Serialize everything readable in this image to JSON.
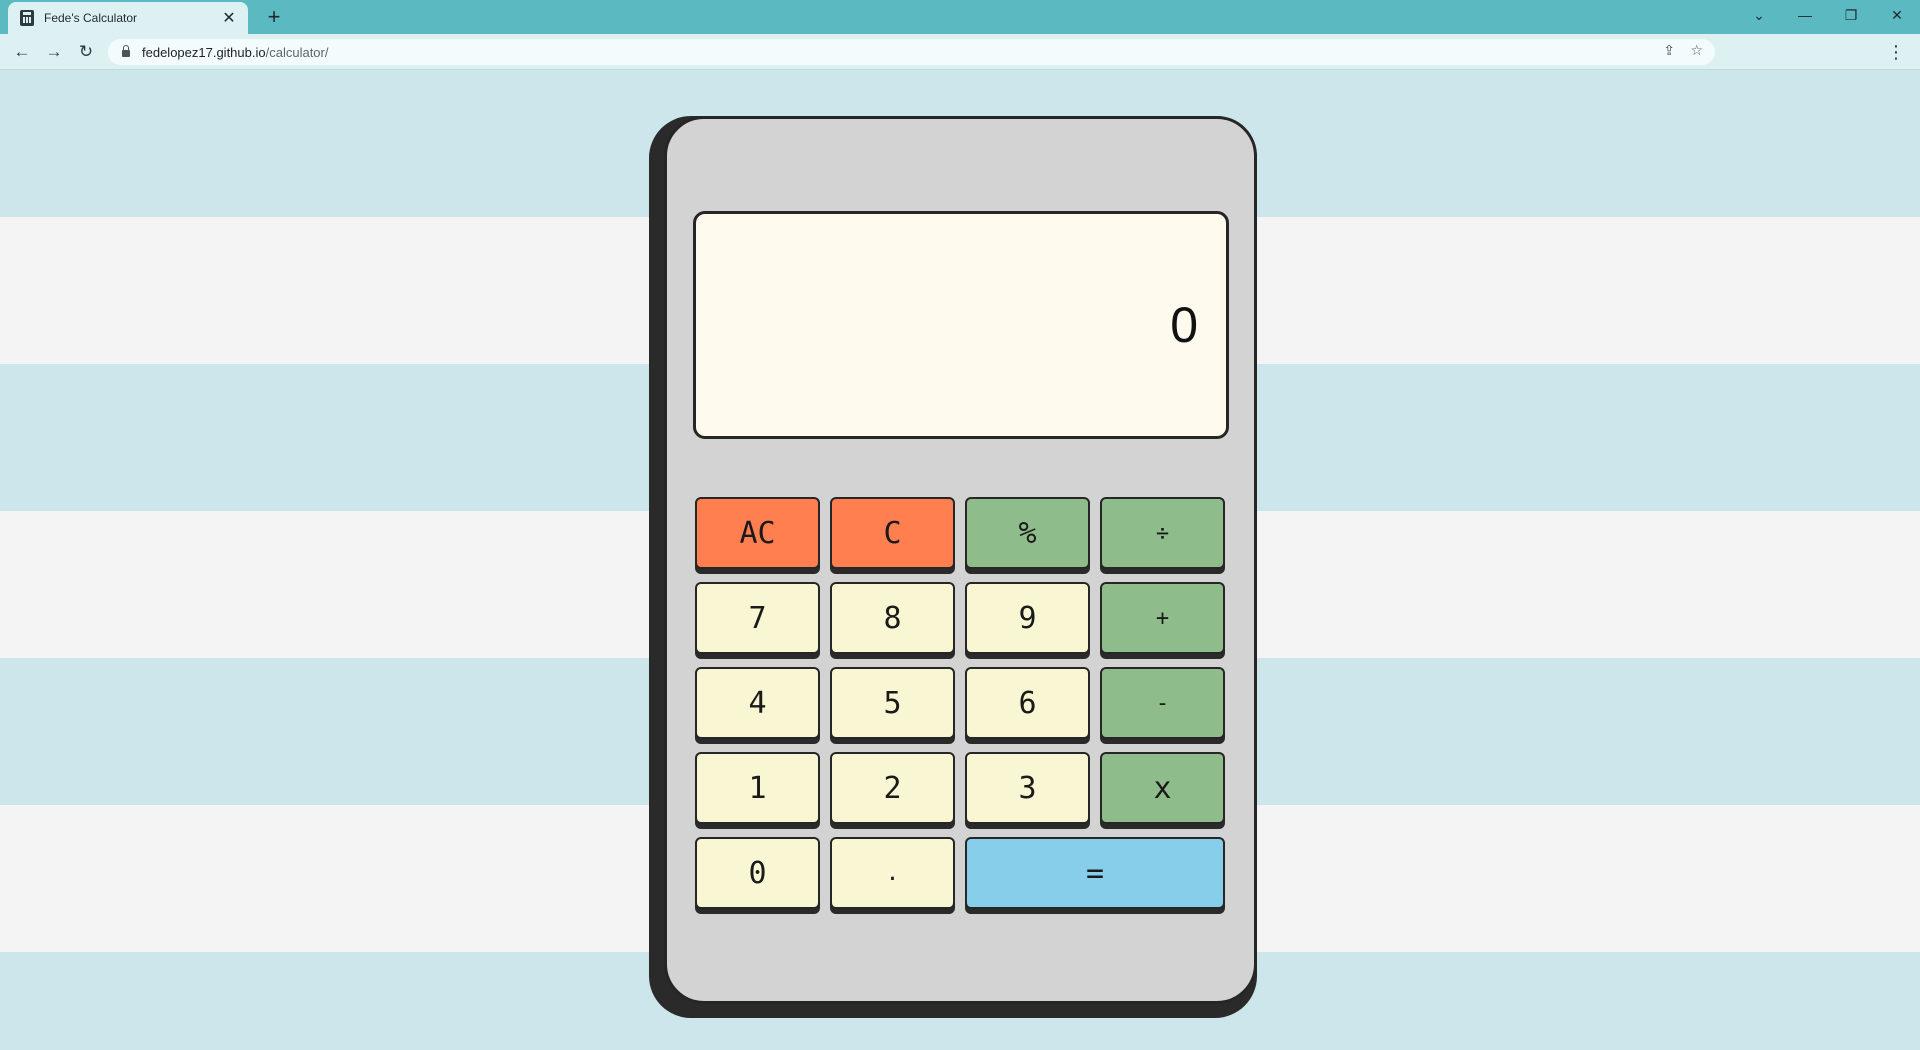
{
  "browser": {
    "tab_title": "Fede's Calculator",
    "tab_close": "✕",
    "new_tab": "+",
    "url_host": "fedelopez17.github.io",
    "url_path": "/calculator/",
    "window_controls": {
      "dropdown": "⌄",
      "minimize": "—",
      "restore": "❐",
      "close": "✕"
    },
    "nav": {
      "back": "←",
      "forward": "→",
      "reload": "↻"
    },
    "share_icon": "⇪",
    "star_icon": "☆",
    "menu_icon": "⋮"
  },
  "calculator": {
    "display": "0",
    "keys": {
      "ac": "AC",
      "c": "C",
      "percent": "%",
      "divide": "÷",
      "seven": "7",
      "eight": "8",
      "nine": "9",
      "plus": "+",
      "four": "4",
      "five": "5",
      "six": "6",
      "minus": "-",
      "one": "1",
      "two": "2",
      "three": "3",
      "multiply": "x",
      "zero": "0",
      "decimal": ".",
      "equals": "="
    },
    "colors": {
      "body": "#d3d3d3",
      "display_bg": "#fffaee",
      "number_key": "#f9f7d3",
      "clear_key": "#ff7f50",
      "operator_key": "#8fbc8b",
      "equals_key": "#87ceeb"
    }
  }
}
